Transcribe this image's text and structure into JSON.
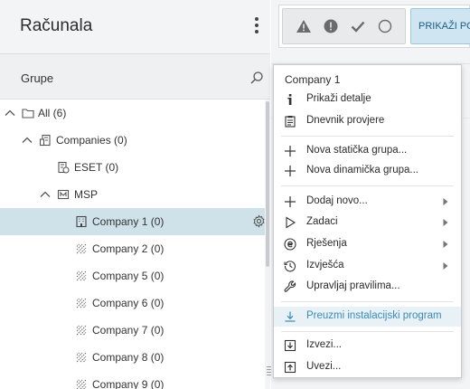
{
  "header": {
    "title": "Računala"
  },
  "groups": {
    "label": "Grupe"
  },
  "tree": [
    {
      "label": "All (6)",
      "icon": "folder-icon"
    },
    {
      "label": "Companies (0)",
      "icon": "companies-icon"
    },
    {
      "label": "ESET (0)",
      "icon": "dynamic-group-icon"
    },
    {
      "label": "MSP",
      "icon": "msp-icon"
    },
    {
      "label": "Company 1 (0)",
      "icon": "building-icon"
    },
    {
      "label": "Company 2 (0)",
      "icon": "building-hatched-icon"
    },
    {
      "label": "Company 5 (0)",
      "icon": "building-hatched-icon"
    },
    {
      "label": "Company 6 (0)",
      "icon": "building-hatched-icon"
    },
    {
      "label": "Company 7 (0)",
      "icon": "building-hatched-icon"
    },
    {
      "label": "Company 8 (0)",
      "icon": "building-hatched-icon"
    },
    {
      "label": "Company 9 (0)",
      "icon": "building-hatched-icon"
    }
  ],
  "toolbar": {
    "status_icons": [
      "warning-icon",
      "error-icon",
      "check-icon",
      "circle-icon"
    ],
    "show_button": "PRIKAŽI PO"
  },
  "menu": {
    "title": "Company 1",
    "items": [
      {
        "label": "Prikaži detalje",
        "icon": "info-icon"
      },
      {
        "label": "Dnevnik provjere",
        "icon": "clipboard-icon"
      },
      {
        "label": "Nova statička grupa...",
        "icon": "plus-icon"
      },
      {
        "label": "Nova dinamička grupa...",
        "icon": "plus-icon"
      },
      {
        "label": "Dodaj novo...",
        "icon": "plus-icon",
        "submenu": true
      },
      {
        "label": "Zadaci",
        "icon": "play-icon",
        "submenu": true
      },
      {
        "label": "Rješenja",
        "icon": "eset-icon",
        "submenu": true
      },
      {
        "label": "Izvješća",
        "icon": "history-icon",
        "submenu": true
      },
      {
        "label": "Upravljaj pravilima...",
        "icon": "wrench-icon"
      },
      {
        "label": "Preuzmi instalacijski program",
        "icon": "download-icon",
        "highlighted": true
      },
      {
        "label": "Izvezi...",
        "icon": "export-icon"
      },
      {
        "label": "Uvezi...",
        "icon": "import-icon"
      }
    ]
  },
  "colors": {
    "selection": "#cfe2ea",
    "accent": "#3b8ab6",
    "highlight_bg": "#e8f1f6"
  }
}
